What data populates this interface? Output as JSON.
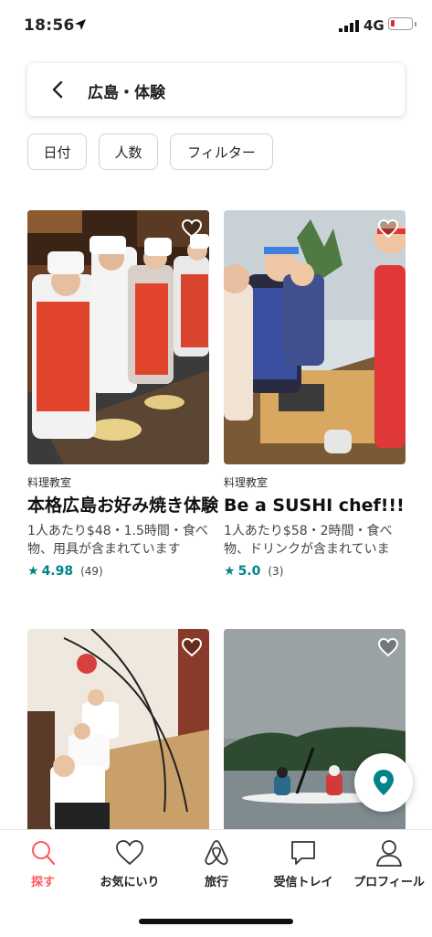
{
  "status": {
    "time": "18:56",
    "network": "4G"
  },
  "search": {
    "title": "広島・体験"
  },
  "filters": [
    {
      "label": "日付"
    },
    {
      "label": "人数"
    },
    {
      "label": "フィルター"
    }
  ],
  "listings": [
    {
      "category": "料理教室",
      "title": "本格広島お好み焼き体験",
      "description": "1人あたり$48・1.5時間・食べ物、用具が含まれています",
      "rating": "4.98",
      "reviews": "(49)"
    },
    {
      "category": "料理教室",
      "title": "Be a SUSHI chef!!!",
      "description": "1人あたり$58・2時間・食べ物、ドリンクが含まれていま",
      "rating": "5.0",
      "reviews": "(3)"
    }
  ],
  "tabs": [
    {
      "label": "探す",
      "icon": "search-icon",
      "active": true
    },
    {
      "label": "お気にいり",
      "icon": "heart-icon"
    },
    {
      "label": "旅行",
      "icon": "airbnb-logo-icon"
    },
    {
      "label": "受信トレイ",
      "icon": "message-icon"
    },
    {
      "label": "プロフィール",
      "icon": "person-icon"
    }
  ],
  "colors": {
    "accent": "#FF5A5F",
    "teal": "#008489"
  }
}
